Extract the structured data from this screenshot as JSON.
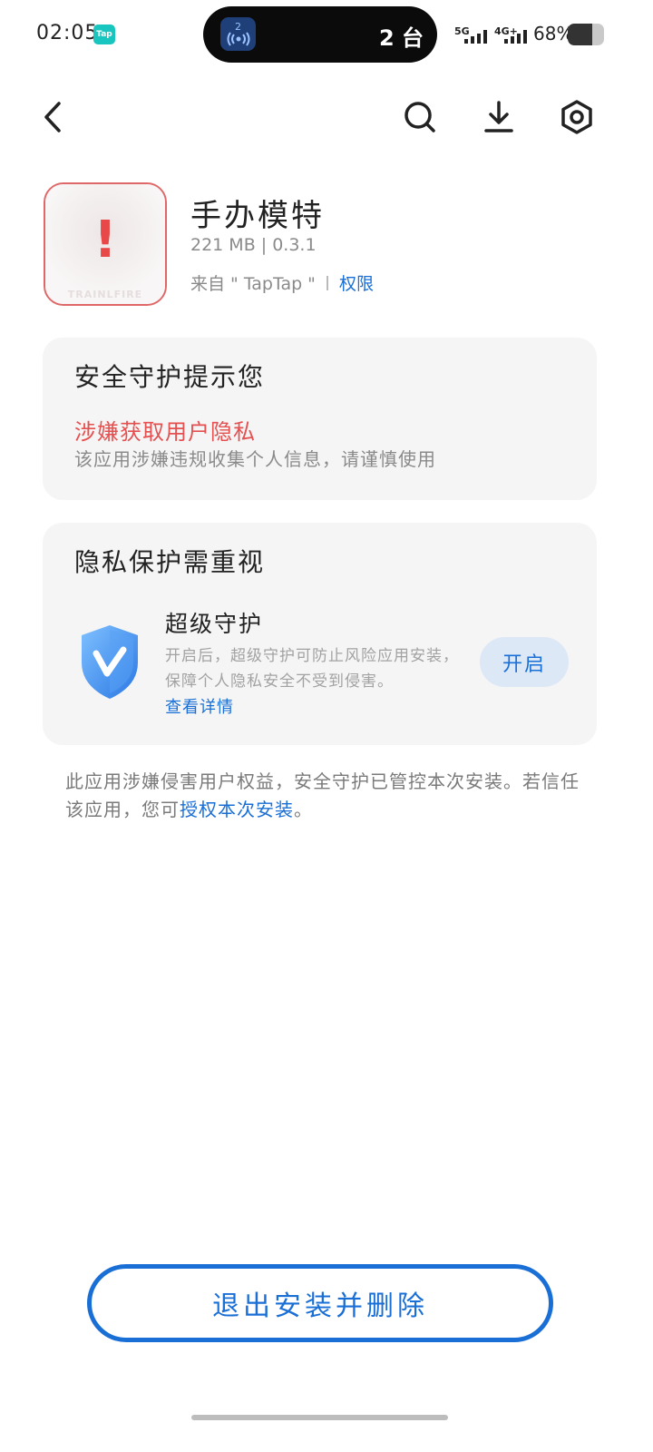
{
  "status_bar": {
    "time": "02:05",
    "notif_badge": "Tap",
    "island_icon_count": "2",
    "island_text": "2 台",
    "network1": "5G",
    "network2": "4G+",
    "battery_pct": "68%",
    "battery_level": 0.68
  },
  "toolbar": {
    "back_icon": "chevron-left-icon",
    "search_icon": "search-icon",
    "download_icon": "download-icon",
    "settings_icon": "hexagon-settings-icon"
  },
  "app": {
    "name": "手办模特",
    "meta": "221 MB  |  0.3.1",
    "source": "来自 \" TapTap \"",
    "permissions_link": "权限",
    "icon_watermark": "TRAINLFIRE"
  },
  "security_card": {
    "title": "安全守护提示您",
    "risk_title": "涉嫌获取用户隐私",
    "risk_desc": "该应用涉嫌违规收集个人信息，请谨慎使用"
  },
  "privacy_card": {
    "title": "隐私保护需重视",
    "guard_title": "超级守护",
    "guard_desc": "开启后，超级守护可防止风险应用安装，保障个人隐私安全不受到侵害。",
    "guard_link": "查看详情",
    "enable_label": "开启"
  },
  "notice": {
    "text": "此应用涉嫌侵害用户权益，安全守护已管控本次安装。若信任该应用，您可",
    "link": "授权本次安装",
    "suffix": "。"
  },
  "footer": {
    "exit_label": "退出安装并删除"
  },
  "colors": {
    "accent": "#1a6fd6",
    "danger": "#e55050",
    "card_bg": "#f5f5f5"
  }
}
